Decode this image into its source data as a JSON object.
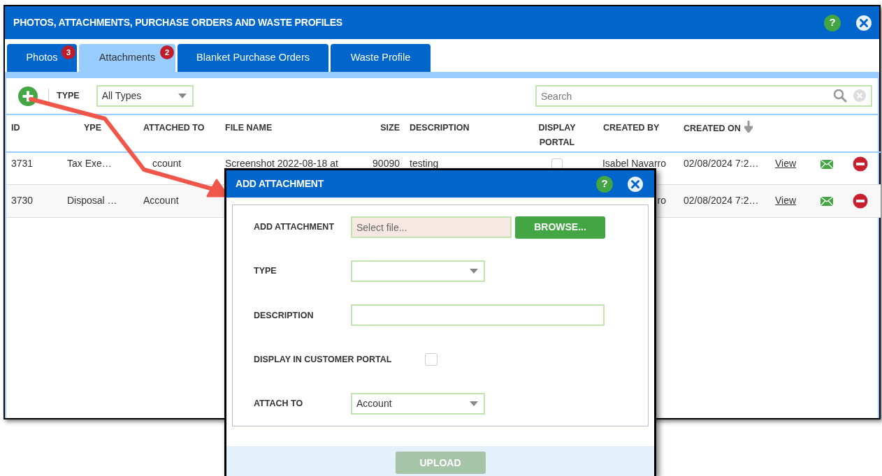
{
  "window": {
    "title": "PHOTOS, ATTACHMENTS, PURCHASE ORDERS AND WASTE PROFILES",
    "help": "?"
  },
  "tabs": [
    {
      "label": "Photos",
      "badge": "3",
      "selected": false
    },
    {
      "label": "Attachments",
      "badge": "2",
      "selected": true
    },
    {
      "label": "Blanket Purchase Orders",
      "selected": false
    },
    {
      "label": "Waste Profile",
      "selected": false
    }
  ],
  "toolbar": {
    "type_label": "TYPE",
    "type_filter": "All Types",
    "search": {
      "placeholder": "Search"
    }
  },
  "table": {
    "columns": [
      {
        "label": "ID"
      },
      {
        "label": "YPE"
      },
      {
        "label": "ATTACHED TO"
      },
      {
        "label": "FILE NAME"
      },
      {
        "label": "SIZE"
      },
      {
        "label": "DESCRIPTION"
      },
      {
        "label": "DISPLAY PORTAL"
      },
      {
        "label": "CREATED BY"
      },
      {
        "label": "CREATED ON",
        "sorted": true
      }
    ],
    "rows": [
      {
        "id": "3731",
        "type": "Tax Exe…",
        "attached_to": "ccount",
        "file_name": "Screenshot 2022-08-18 at",
        "size": "90090",
        "description": "testing",
        "display_portal": false,
        "created_by": "Isabel Navarro",
        "created_on": "02/08/2024 7:2…",
        "action": "View"
      },
      {
        "id": "3730",
        "type": "Disposal …",
        "attached_to": "Account",
        "created_by": "ro",
        "created_on": "02/08/2024 7:2…",
        "action": "View"
      }
    ]
  },
  "dialog": {
    "title": "ADD ATTACHMENT",
    "help": "?",
    "fields": [
      {
        "kind": "file",
        "label": "ADD ATTACHMENT",
        "placeholder": "Select file...",
        "button": "BROWSE..."
      },
      {
        "kind": "select",
        "label": "TYPE"
      },
      {
        "kind": "text",
        "label": "DESCRIPTION"
      },
      {
        "kind": "checkbox",
        "label": "DISPLAY IN CUSTOMER PORTAL",
        "checked": false
      },
      {
        "kind": "select",
        "label": "ATTACH TO",
        "value": "Account"
      }
    ],
    "upload_button": {
      "label": "UPLOAD",
      "disabled": true
    }
  }
}
